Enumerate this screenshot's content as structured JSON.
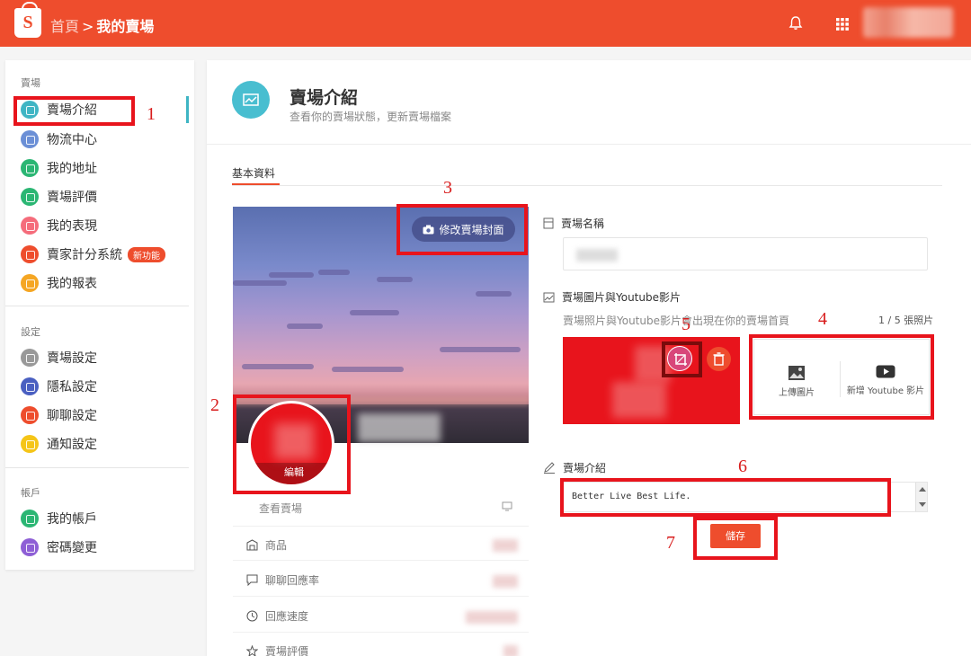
{
  "topbar": {
    "home": "首頁",
    "separator": ">",
    "current": "我的賣場"
  },
  "sidebar": {
    "sections": [
      {
        "title": "賣場",
        "items": [
          {
            "label": "賣場介紹",
            "color": "#3fb5c4"
          },
          {
            "label": "物流中心",
            "color": "#6b8fd6"
          },
          {
            "label": "我的地址",
            "color": "#2bb673"
          },
          {
            "label": "賣場評價",
            "color": "#2bb673"
          },
          {
            "label": "我的表現",
            "color": "#f56c7b"
          },
          {
            "label": "賣家計分系統",
            "color": "#ee4d2d",
            "badge": "新功能"
          },
          {
            "label": "我的報表",
            "color": "#f5a623"
          }
        ]
      },
      {
        "title": "設定",
        "items": [
          {
            "label": "賣場設定",
            "color": "#999999"
          },
          {
            "label": "隱私設定",
            "color": "#4a5fc1"
          },
          {
            "label": "聊聊設定",
            "color": "#ee4d2d"
          },
          {
            "label": "通知設定",
            "color": "#f5c518"
          }
        ]
      },
      {
        "title": "帳戶",
        "items": [
          {
            "label": "我的帳戶",
            "color": "#2bb673"
          },
          {
            "label": "密碼變更",
            "color": "#8e5fd6"
          }
        ]
      }
    ]
  },
  "header": {
    "title": "賣場介紹",
    "subtitle": "查看你的賣場狀態，更新賣場檔案"
  },
  "tabs": {
    "basic": "基本資料"
  },
  "cover": {
    "change_cover": "修改賣場封面",
    "edit_avatar": "編輯"
  },
  "stats": {
    "view_shop": "查看賣場",
    "products": "商品",
    "chat_rate": "聊聊回應率",
    "response_time": "回應速度",
    "rating": "賣場評價"
  },
  "form": {
    "shop_name_label": "賣場名稱",
    "media_label": "賣場圖片與Youtube影片",
    "media_desc": "賣場照片與Youtube影片會出現在你的賣場首頁",
    "media_count": "1 / 5 張照片",
    "upload_image": "上傳圖片",
    "add_youtube": "新增 Youtube 影片",
    "intro_label": "賣場介紹",
    "intro_value": "Better Live Best Life.",
    "save": "儲存"
  },
  "annotations": {
    "n1": "1",
    "n2": "2",
    "n3": "3",
    "n4": "4",
    "n5": "5",
    "n6": "6",
    "n7": "7"
  },
  "colors": {
    "brand": "#ee4d2d",
    "annotation": "#e8141c",
    "accent": "#3fb5c4"
  }
}
